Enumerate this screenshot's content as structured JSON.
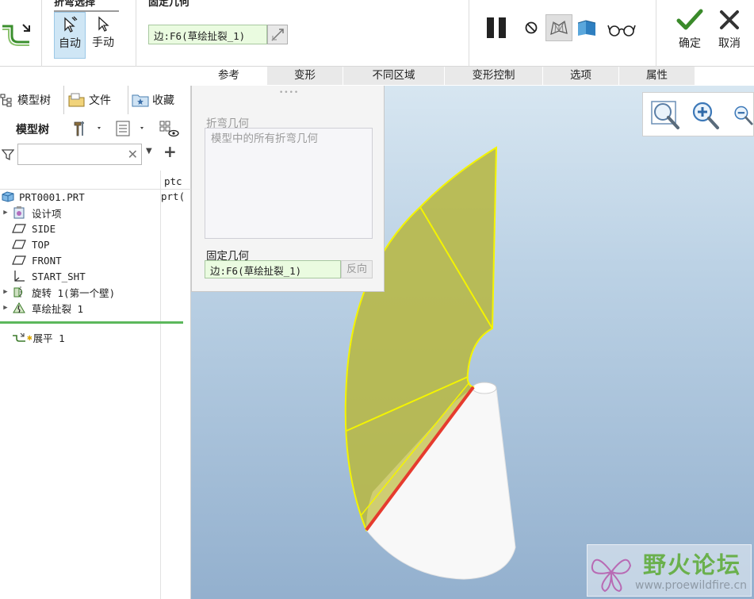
{
  "ribbon": {
    "bend_select": {
      "title": "折弯选择",
      "auto_label": "自动",
      "manual_label": "手动"
    },
    "fixed_geom": {
      "title": "固定几何",
      "value": "边:F6(草绘扯裂_1)"
    },
    "ok_label": "确定",
    "cancel_label": "取消"
  },
  "tabs": [
    "参考",
    "变形",
    "不同区域",
    "变形控制",
    "选项",
    "属性"
  ],
  "left": {
    "tabs": [
      "模型树",
      "文件",
      "收藏"
    ],
    "tree_header": "模型树",
    "search_placeholder": "",
    "col_header": "ptc",
    "col_value": "prt(",
    "tree": [
      {
        "label": "PRT0001.PRT",
        "icon": "part-icon"
      },
      {
        "label": "设计项",
        "icon": "design-items-icon"
      },
      {
        "label": "SIDE",
        "icon": "datum-plane-icon"
      },
      {
        "label": "TOP",
        "icon": "datum-plane-icon"
      },
      {
        "label": "FRONT",
        "icon": "datum-plane-icon"
      },
      {
        "label": "START_SHT",
        "icon": "csys-icon"
      },
      {
        "label": "旋转 1(第一个壁)",
        "icon": "revolve-icon"
      },
      {
        "label": "草绘扯裂 1",
        "icon": "sketch-rip-icon"
      },
      {
        "label": "展平 1",
        "icon": "flatten-icon"
      }
    ]
  },
  "ref_panel": {
    "bend_geom_label": "折弯几何",
    "bend_geom_placeholder": "模型中的所有折弯几何",
    "fixed_geom_label": "固定几何",
    "fixed_geom_value": "边:F6(草绘扯裂_1)",
    "flip_label": "反向"
  },
  "watermark": {
    "title": "野火论坛",
    "url": "www.proewildfire.cn"
  },
  "colors": {
    "accent_green": "#3a8a2a",
    "surface_yellow": "#b7b848",
    "edge_red": "#e63b2e",
    "tab_bg": "#e9e9e9"
  }
}
